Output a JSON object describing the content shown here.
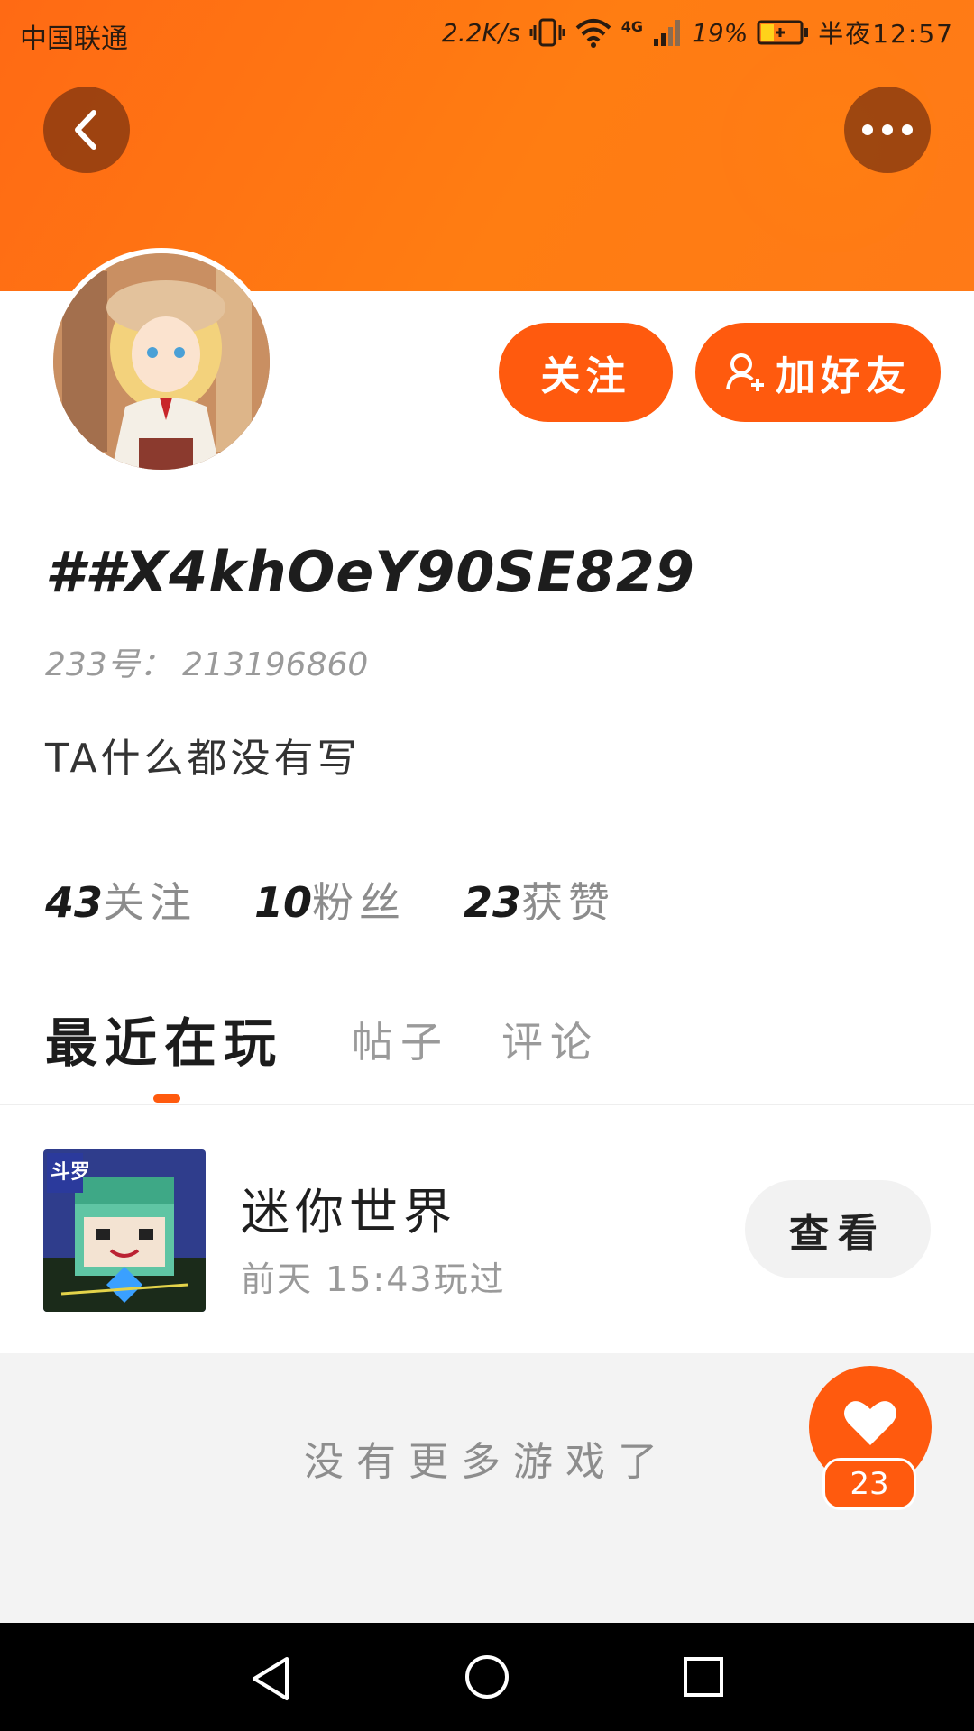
{
  "status_bar": {
    "carrier": "中国联通",
    "speed": "2.2K/s",
    "network": "4G",
    "battery": "19%",
    "time": "半夜12:57"
  },
  "header": {
    "back_icon": "chevron-left-icon",
    "more_icon": "more-dots-icon"
  },
  "profile": {
    "follow_label": "关注",
    "add_friend_label": "加好友",
    "username": "##X4khOeY90SE829",
    "uid_text": "233号： 213196860",
    "bio": "TA什么都没有写",
    "stats": [
      {
        "num": "43",
        "label": "关注"
      },
      {
        "num": "10",
        "label": "粉丝"
      },
      {
        "num": "23",
        "label": "获赞"
      }
    ]
  },
  "tabs": [
    {
      "label": "最近在玩",
      "active": true
    },
    {
      "label": "帖子",
      "active": false
    },
    {
      "label": "评论",
      "active": false
    }
  ],
  "games": [
    {
      "name": "迷你世界",
      "played": "前天 15:43玩过",
      "button": "查看",
      "icon_badge": "斗罗"
    }
  ],
  "footer": {
    "no_more": "没有更多游戏了",
    "like_count": "23"
  },
  "colors": {
    "accent": "#ff5a0e",
    "header": "#ff7a14"
  }
}
